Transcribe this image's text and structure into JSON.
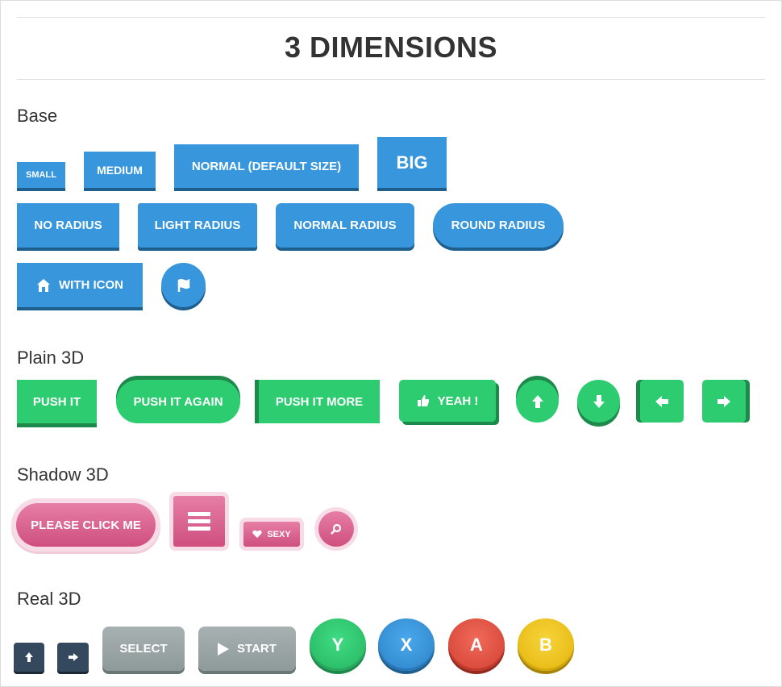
{
  "title": "3 DIMENSIONS",
  "sections": {
    "base": "Base",
    "plain": "Plain 3D",
    "shadow": "Shadow 3D",
    "real": "Real 3D"
  },
  "base": {
    "small": "SMALL",
    "medium": "MEDIUM",
    "normal": "NORMAL (DEFAULT SIZE)",
    "big": "BIG",
    "no_radius": "NO RADIUS",
    "light_radius": "LIGHT RADIUS",
    "normal_radius": "NORMAL RADIUS",
    "round_radius": "ROUND RADIUS",
    "with_icon": "WITH ICON",
    "with_icon_icon": "home-icon",
    "flag_icon": "flag-icon"
  },
  "plain": {
    "push_it": "PUSH IT",
    "push_it_again": "PUSH IT AGAIN",
    "push_it_more": "PUSH IT MORE",
    "yeah": "YEAH !",
    "yeah_icon": "thumbs-up-icon",
    "icons": [
      "arrow-up-icon",
      "arrow-down-icon",
      "arrow-left-icon",
      "arrow-right-icon"
    ]
  },
  "shadow": {
    "please_click": "PLEASE CLICK ME",
    "menu_icon": "menu-icon",
    "sexy": "SEXY",
    "sexy_icon": "heart-icon",
    "search_icon": "search-icon"
  },
  "real": {
    "up_icon": "arrow-up-icon",
    "right_icon": "arrow-right-icon",
    "select": "SELECT",
    "start": "START",
    "start_icon": "play-icon",
    "y": "Y",
    "x": "X",
    "a": "A",
    "b": "B"
  },
  "colors": {
    "blue": "#3796dc",
    "green": "#2ecc71",
    "pink": "#d9608d",
    "dark": "#34495e",
    "grey": "#95a5a6",
    "y_green": "#2ecc71",
    "x_blue": "#3796dc",
    "a_red": "#e74c3c",
    "b_yellow": "#f1c40f"
  }
}
